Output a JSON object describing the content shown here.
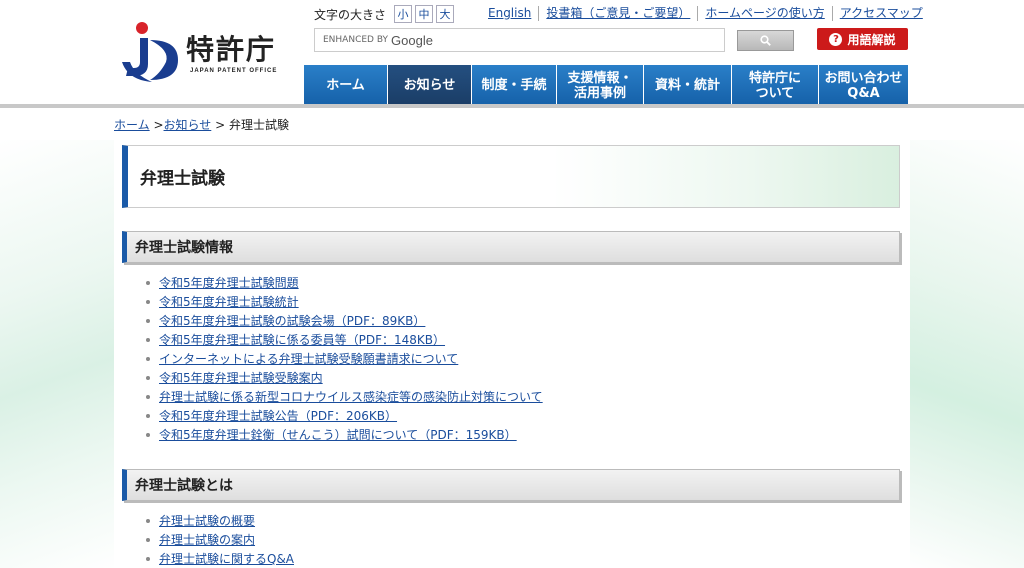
{
  "header": {
    "logo_text": "特許庁",
    "logo_sub": "JAPAN PATENT OFFICE",
    "fontsize_label": "文字の大きさ",
    "fontsize_options": [
      "小",
      "中",
      "大"
    ],
    "top_links": [
      "English",
      "投書箱（ご意見・ご要望）",
      "ホームページの使い方",
      "アクセスマップ"
    ],
    "search_prefix": "ENHANCED BY",
    "search_brand": "Google",
    "search_button_icon": "search-icon",
    "glossary_label": "用語解説",
    "glossary_icon": "?"
  },
  "nav": {
    "items": [
      {
        "label": "ホーム"
      },
      {
        "label": "お知らせ"
      },
      {
        "label": "制度・手続"
      },
      {
        "label": "支援情報・\n活用事例"
      },
      {
        "label": "資料・統計"
      },
      {
        "label": "特許庁に\nついて"
      },
      {
        "label": "お問い合わせ\nQ&A"
      }
    ],
    "active_index": 1
  },
  "breadcrumb": {
    "items": [
      "ホーム",
      "お知らせ"
    ],
    "separator": ">",
    "current": "弁理士試験"
  },
  "page": {
    "title": "弁理士試験",
    "sections": [
      {
        "heading": "弁理士試験情報",
        "links": [
          "令和5年度弁理士試験問題",
          "令和5年度弁理士試験統計",
          "令和5年度弁理士試験の試験会場（PDF：89KB）",
          "令和5年度弁理士試験に係る委員等（PDF：148KB）",
          "インターネットによる弁理士試験受験願書請求について",
          "令和5年度弁理士試験受験案内",
          "弁理士試験に係る新型コロナウイルス感染症等の感染防止対策について",
          "令和5年度弁理士試験公告（PDF：206KB）",
          "令和5年度弁理士銓衡（せんこう）試問について（PDF：159KB）"
        ]
      },
      {
        "heading": "弁理士試験とは",
        "links": [
          "弁理士試験の概要",
          "弁理士試験の案内",
          "弁理士試験に関するQ&A"
        ]
      }
    ]
  },
  "colors": {
    "nav_blue": "#1560a8",
    "nav_active": "#1a3d66",
    "link": "#1a4d9c",
    "glossary_red": "#cc1a1a",
    "accent_border": "#1a5aa8"
  }
}
